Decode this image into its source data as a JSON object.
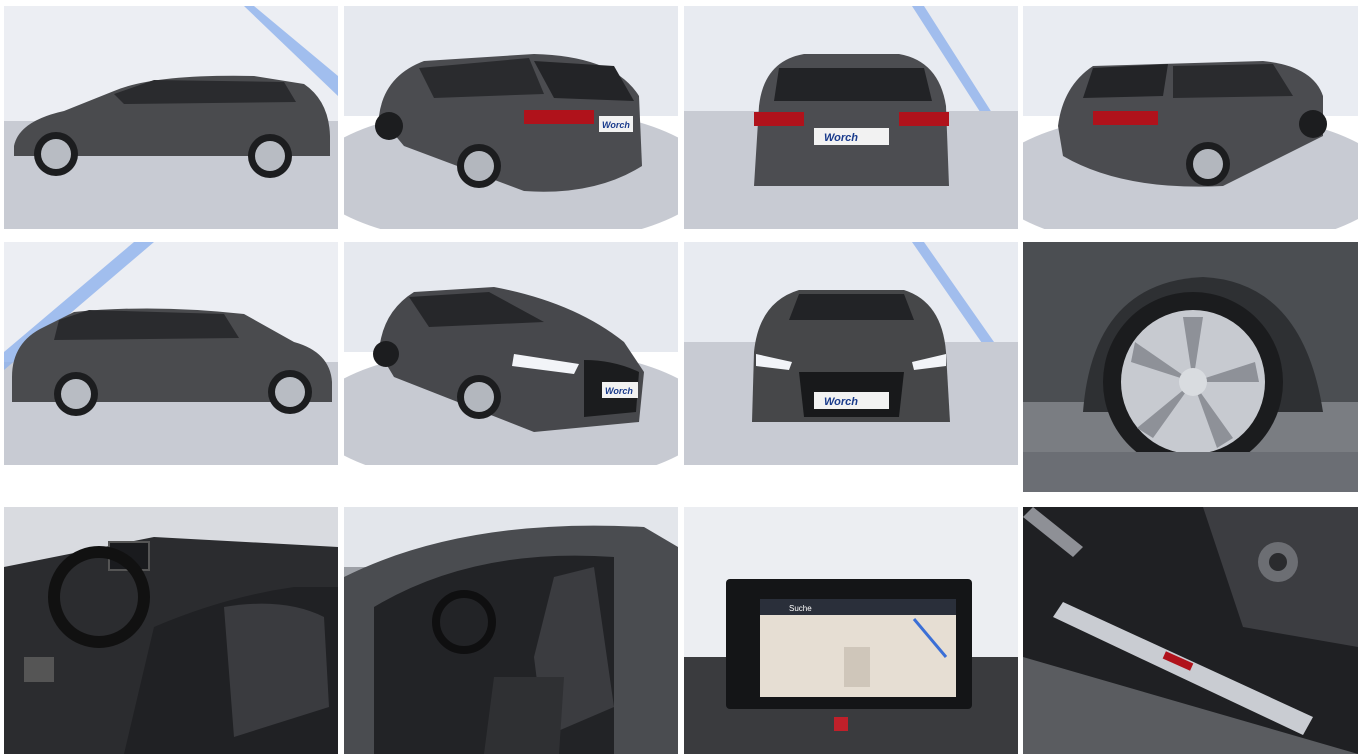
{
  "gallery": {
    "photos": [
      {
        "subject": "side-profile-left",
        "plate": ""
      },
      {
        "subject": "rear-three-quarter-left",
        "plate": "Worch"
      },
      {
        "subject": "rear",
        "plate": "Worch"
      },
      {
        "subject": "rear-three-quarter-right",
        "plate": ""
      },
      {
        "subject": "side-profile-right",
        "plate": ""
      },
      {
        "subject": "front-three-quarter-left",
        "plate": "Worch"
      },
      {
        "subject": "front",
        "plate": "Worch"
      },
      {
        "subject": "wheel-closeup",
        "plate": ""
      },
      {
        "subject": "cockpit-interior",
        "plate": ""
      },
      {
        "subject": "front-seats-open-door",
        "plate": ""
      },
      {
        "subject": "infotainment-screen",
        "plate": "Suche"
      },
      {
        "subject": "door-sill-seat-controls",
        "plate": ""
      }
    ]
  },
  "colors": {
    "studio_wall": "#e9ecf2",
    "studio_floor": "#c9ccd4",
    "car_body": "#4a4b4e",
    "taillight": "#b0121b",
    "light_stripe": "#7aa5e8"
  }
}
